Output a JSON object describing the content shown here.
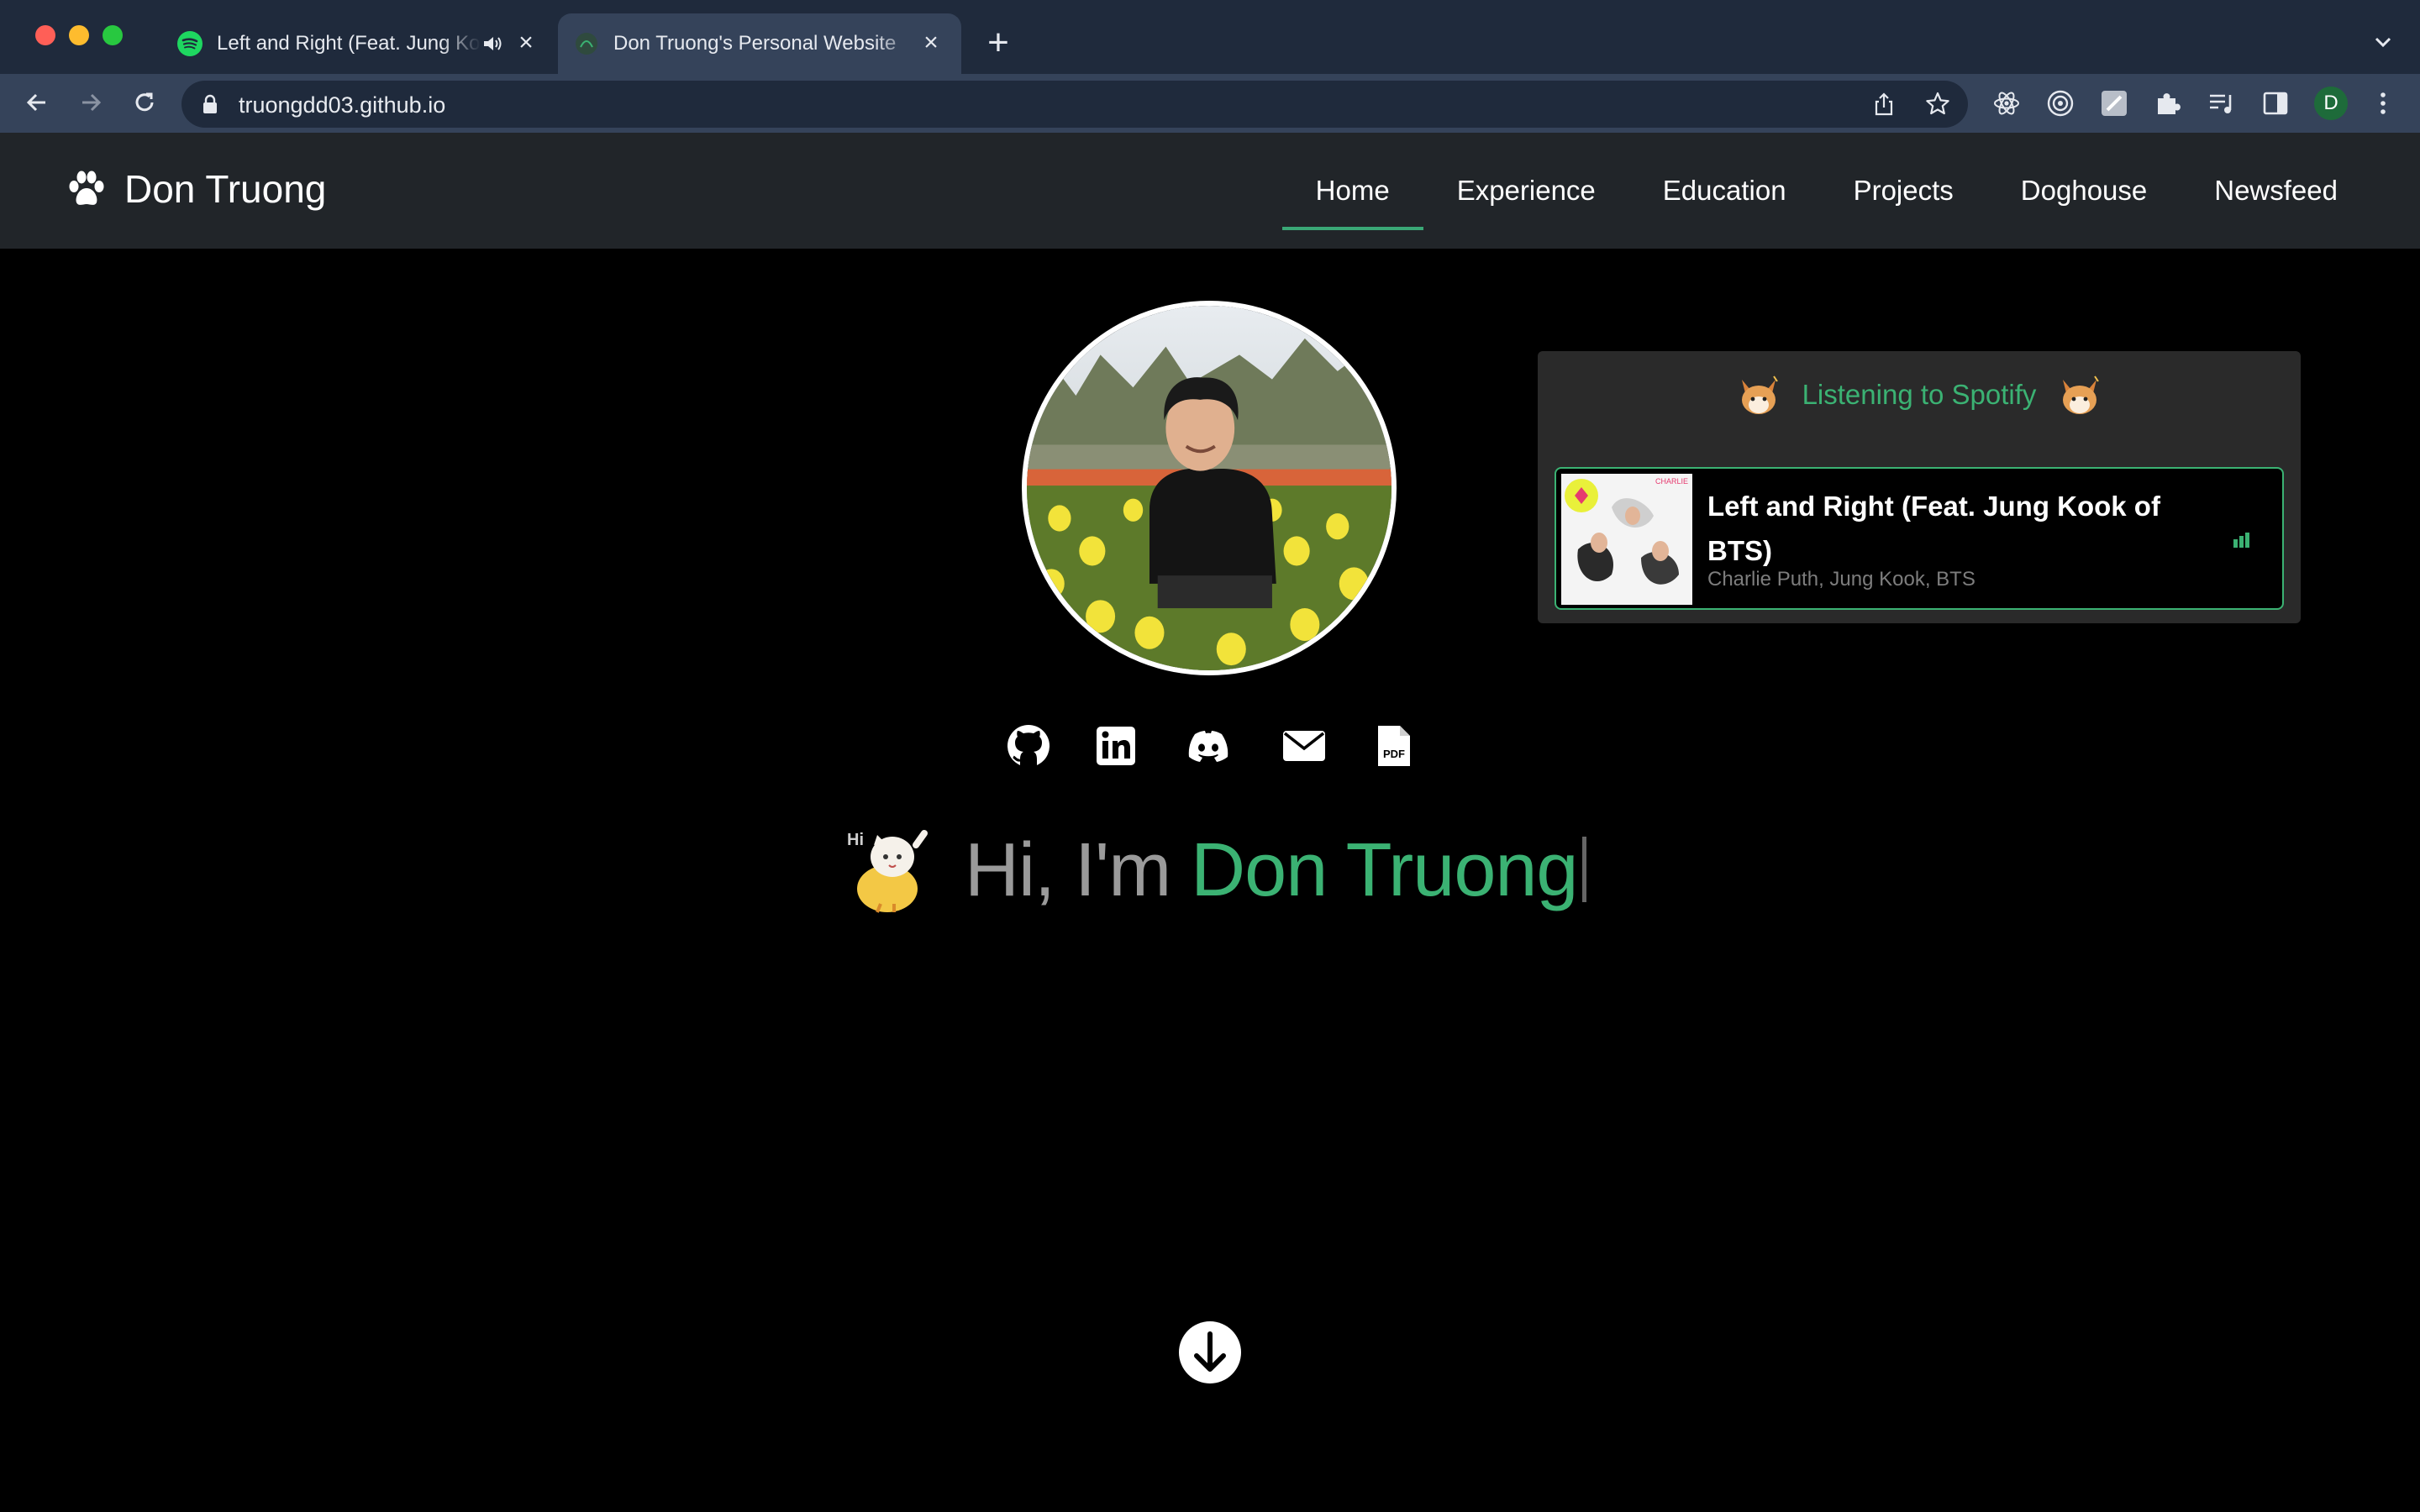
{
  "browser": {
    "tabs": [
      {
        "title": "Left and Right (Feat. Jung Kook of BTS) · Charlie Puth, Jung Kook, BTS",
        "favicon": "spotify-icon",
        "audio": "speaker-icon",
        "active": false
      },
      {
        "title": "Don Truong's Personal Website",
        "favicon": "site-icon",
        "active": true
      }
    ],
    "url": "truongdd03.github.io",
    "profile_initial": "D",
    "colors": {
      "tabbar": "#1f2a3c",
      "toolbar": "#35435a"
    }
  },
  "site": {
    "brand": "Don Truong",
    "nav": [
      "Home",
      "Experience",
      "Education",
      "Projects",
      "Doghouse",
      "Newsfeed"
    ],
    "active_nav": "Home"
  },
  "spotify": {
    "heading": "Listening to Spotify",
    "track": "Left and Right (Feat. Jung Kook of BTS)",
    "artists": "Charlie Puth, Jung Kook, BTS"
  },
  "socials": [
    "github-icon",
    "linkedin-icon",
    "discord-icon",
    "mail-icon",
    "pdf-icon"
  ],
  "hero": {
    "prefix": "Hi, I'm ",
    "name": "Don Truong"
  },
  "accent": "#3bb273"
}
